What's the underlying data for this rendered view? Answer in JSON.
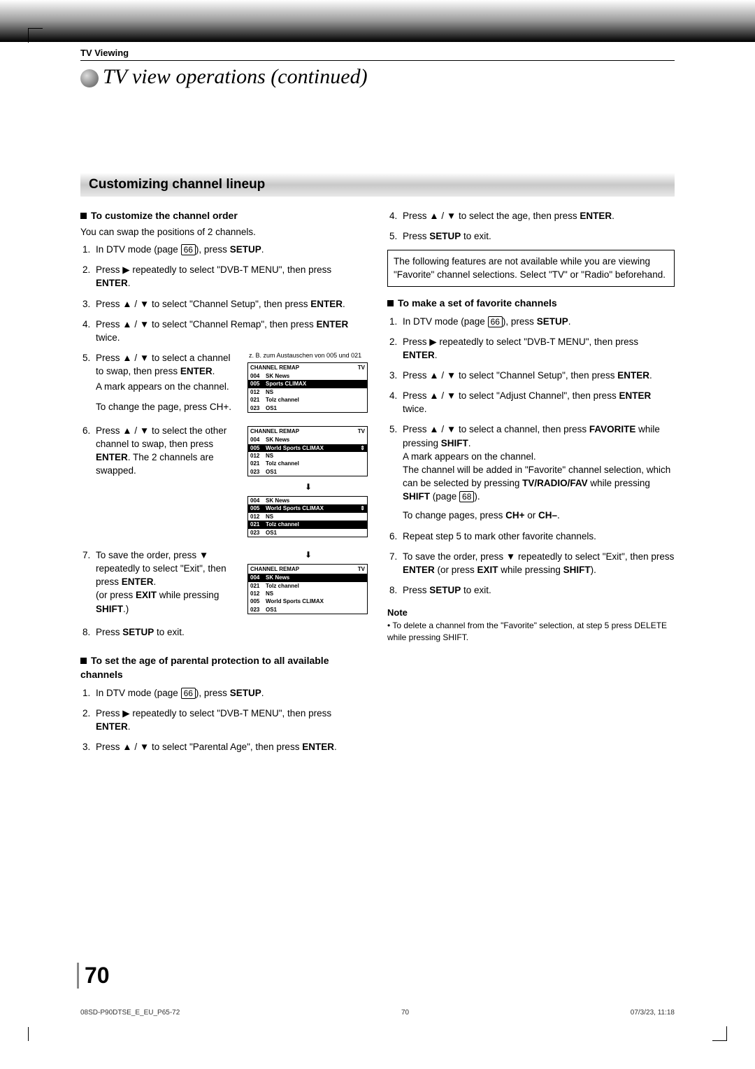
{
  "header": {
    "section": "TV Viewing",
    "title": "TV view operations (continued)"
  },
  "bar_title": "Customizing channel lineup",
  "left": {
    "h1": "To customize the channel order",
    "h1_sub": "You can swap the positions of 2 channels.",
    "s1a": "In DTV mode (page ",
    "s1_ref": "66",
    "s1b": "), press ",
    "s1c": "SETUP",
    "s1d": ".",
    "s2a": "Press ▶ repeatedly to select \"DVB-T MENU\", then press ",
    "s2b": "ENTER",
    "s2c": ".",
    "s3a": "Press ▲ / ▼ to select \"Channel Setup\", then press ",
    "s3b": "ENTER",
    "s3c": ".",
    "s4a": "Press ▲ / ▼  to select \"Channel Remap\", then press ",
    "s4b": "ENTER",
    "s4c": " twice.",
    "s5a": "Press ▲ / ▼ to select a channel to swap, then press ",
    "s5b": "ENTER",
    "s5c": ".",
    "s5d": "A mark appears on the channel.",
    "s5e": "To change the page, press CH+.",
    "s5_caption": "z. B. zum Austauschen von 005 und 021",
    "s6a": "Press ▲ / ▼ to select the other channel to swap, then press ",
    "s6b": "ENTER",
    "s6c": ". The 2 channels are swapped.",
    "s7a": "To save the order, press ▼ repeatedly to select \"Exit\", then press ",
    "s7b": "ENTER",
    "s7c": ".",
    "s7d": "(or press ",
    "s7e": "EXIT",
    "s7f": " while pressing ",
    "s7g": "SHIFT",
    "s7h": ".)",
    "s8a": "Press ",
    "s8b": "SETUP",
    "s8c": " to exit.",
    "h2": "To set the age of parental protection to all available channels",
    "p1a": "In DTV mode (page ",
    "p1_ref": "66",
    "p1b": "), press ",
    "p1c": "SETUP",
    "p1d": ".",
    "p2a": "Press ▶ repeatedly to select \"DVB-T MENU\", then press ",
    "p2b": "ENTER",
    "p2c": ".",
    "p3a": "Press ▲ / ▼ to select \"Parental Age\", then press ",
    "p3b": "ENTER",
    "p3c": "."
  },
  "right": {
    "r4a": "Press ▲ / ▼ to select the age, then press ",
    "r4b": "ENTER",
    "r4c": ".",
    "r5a": "Press ",
    "r5b": "SETUP",
    "r5c": " to exit.",
    "box": "The following features are not available while you are viewing \"Favorite\" channel selections. Select \"TV\" or \"Radio\" beforehand.",
    "h3": "To make a set of favorite channels",
    "f1a": "In DTV mode (page ",
    "f1_ref": "66",
    "f1b": "), press ",
    "f1c": "SETUP",
    "f1d": ".",
    "f2a": "Press ▶ repeatedly to select \"DVB-T MENU\", then press ",
    "f2b": "ENTER",
    "f2c": ".",
    "f3a": "Press ▲ / ▼ to select \"Channel Setup\", then press ",
    "f3b": "ENTER",
    "f3c": ".",
    "f4a": "Press ▲ / ▼  to select \"Adjust Channel\", then press ",
    "f4b": "ENTER",
    "f4c": " twice.",
    "f5a": "Press ▲ / ▼ to select a channel, then press ",
    "f5b": "FAVORITE",
    "f5c": " while pressing ",
    "f5d": "SHIFT",
    "f5e": ".",
    "f5f": "A mark appears on the channel.",
    "f5g": "The channel will be added in \"Favorite\" channel selection, which can be selected by pressing ",
    "f5h": "TV/RADIO/FAV",
    "f5i": " while pressing ",
    "f5j": "SHIFT",
    "f5k": " (page ",
    "f5_ref": "68",
    "f5l": ").",
    "f5m": "To change pages, press ",
    "f5n": "CH+",
    "f5o": " or ",
    "f5p": "CH–",
    "f5q": ".",
    "f6": "Repeat step 5 to mark other favorite channels.",
    "f7a": "To save the order, press ▼ repeatedly to select \"Exit\", then press ",
    "f7b": "ENTER",
    "f7c": " (or press ",
    "f7d": "EXIT",
    "f7e": " while pressing ",
    "f7f": "SHIFT",
    "f7g": ").",
    "f8a": "Press ",
    "f8b": "SETUP",
    "f8c": " to exit.",
    "note_h": "Note",
    "note": "• To delete a channel from the \"Favorite\" selection, at step 5 press DELETE while pressing SHIFT."
  },
  "shot": {
    "title": "CHANNEL REMAP",
    "tv": "TV",
    "r1n": "004",
    "r1t": "SK News",
    "r2n": "005",
    "r2t": "Sports CLIMAX",
    "r3n": "012",
    "r3t": "NS",
    "r4n": "021",
    "r4t": "Tolz channel",
    "r5n": "023",
    "r5t": "OS1",
    "b2t": "World Sports CLIMAX",
    "c2n": "021",
    "c2t": "Tolz channel",
    "c4n": "005",
    "c4t": "World Sports CLIMAX"
  },
  "page_number": "70",
  "footer": {
    "left": "08SD-P90DTSE_E_EU_P65-72",
    "mid": "70",
    "right": "07/3/23, 11:18"
  }
}
